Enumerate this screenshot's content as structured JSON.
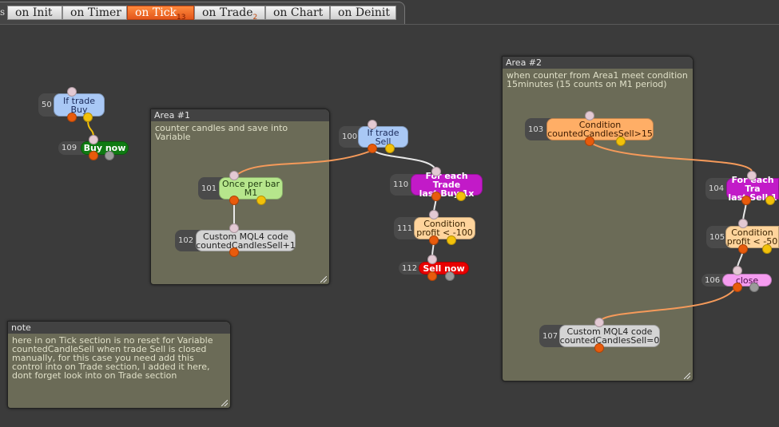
{
  "tabs": {
    "edge_text": "s",
    "items": [
      {
        "label": "on Init",
        "count": ""
      },
      {
        "label": "on Timer",
        "count": ""
      },
      {
        "label": "on Tick",
        "count": "13"
      },
      {
        "label": "on Trade",
        "count": "2"
      },
      {
        "label": "on Chart",
        "count": ""
      },
      {
        "label": "on Deinit",
        "count": ""
      }
    ],
    "active": "on Tick"
  },
  "areas": {
    "area1": {
      "title": "Area #1",
      "desc": "counter candles and save into Variable"
    },
    "area2": {
      "title": "Area #2",
      "desc": "when counter from Area1 meet condition 15minutes (15 counts on M1 period)"
    },
    "note": {
      "title": "note",
      "desc": "here in on Tick section is no reset for Variable countedCandleSell when trade Sell is closed manually, for this case you need add this control into on Trade section, I added it here, dont forget look into on Trade section"
    }
  },
  "nodes": {
    "n50": {
      "id": "50",
      "line1": "If trade",
      "line2": "Buy"
    },
    "n109": {
      "id": "109",
      "line1": "Buy now",
      "line2": ""
    },
    "n100": {
      "id": "100",
      "line1": "If trade",
      "line2": "Sell"
    },
    "n101": {
      "id": "101",
      "line1": "Once per bar",
      "line2": "M1"
    },
    "n102": {
      "id": "102",
      "line1": "Custom MQL4 code",
      "line2": "countedCandlesSell+1"
    },
    "n110": {
      "id": "110",
      "line1": "For each Trade",
      "line2": "last Buy 1x"
    },
    "n111": {
      "id": "111",
      "line1": "Condition",
      "line2": "profit < -100"
    },
    "n112": {
      "id": "112",
      "line1": "Sell now",
      "line2": ""
    },
    "n103": {
      "id": "103",
      "line1": "Condition",
      "line2": "countedCandlesSell>15"
    },
    "n104": {
      "id": "104",
      "line1": "For each Tra",
      "line2": "last Sell 1"
    },
    "n105": {
      "id": "105",
      "line1": "Condition",
      "line2": "profit < -50"
    },
    "n106": {
      "id": "106",
      "line1": "close",
      "line2": ""
    },
    "n107": {
      "id": "107",
      "line1": "Custom MQL4 code",
      "line2": "countedCandlesSell=0"
    }
  },
  "colors": {
    "blue_block": "#a9c8f5",
    "green_block": "#0f7a12",
    "lightgreen_block": "#b6e68c",
    "grey_block": "#d4d4d4",
    "magenta_block": "#c21ac8",
    "peach_block": "#ffd49c",
    "red_block": "#e80000",
    "orange_block": "#ffae66",
    "pink_block": "#f59cf0",
    "link_orange": "#f59a5a",
    "link_white": "#e8e8e8",
    "link_yellow": "#f2c10a"
  }
}
